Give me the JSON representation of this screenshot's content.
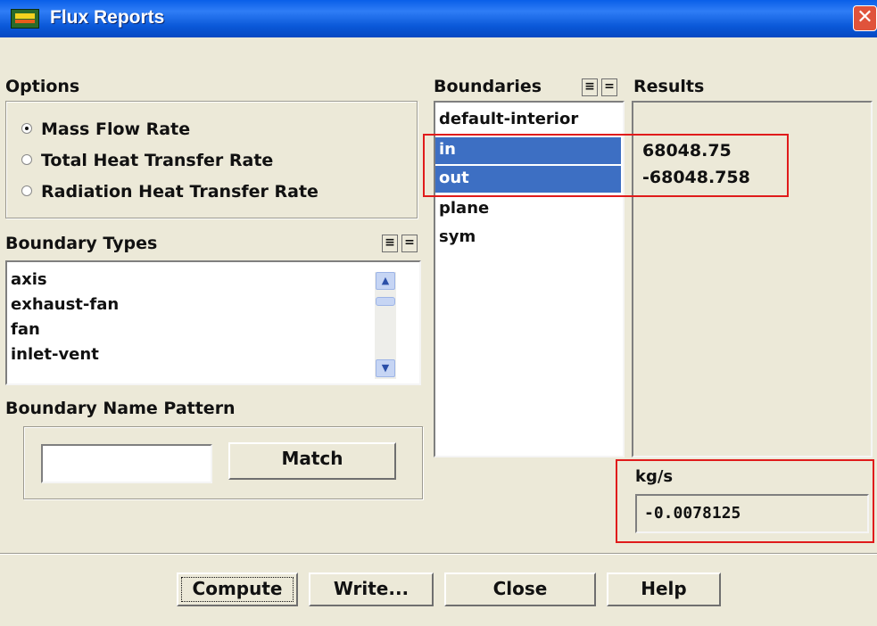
{
  "window": {
    "title": "Flux Reports"
  },
  "options": {
    "label": "Options",
    "radios": [
      {
        "label": "Mass Flow Rate",
        "selected": true
      },
      {
        "label": "Total Heat Transfer Rate",
        "selected": false
      },
      {
        "label": "Radiation Heat Transfer Rate",
        "selected": false
      }
    ]
  },
  "boundary_types": {
    "label": "Boundary Types",
    "items": [
      "axis",
      "exhaust-fan",
      "fan",
      "inlet-vent"
    ]
  },
  "name_pattern": {
    "label": "Boundary Name Pattern",
    "value": "",
    "match_label": "Match"
  },
  "boundaries": {
    "label": "Boundaries",
    "items": [
      {
        "label": "default-interior",
        "selected": false
      },
      {
        "label": "in",
        "selected": true
      },
      {
        "label": "out",
        "selected": true
      },
      {
        "label": "plane",
        "selected": false
      },
      {
        "label": "sym",
        "selected": false
      }
    ]
  },
  "results": {
    "label": "Results",
    "values": [
      "68048.75",
      "-68048.758"
    ],
    "unit": "kg/s",
    "net": "-0.0078125"
  },
  "buttons": {
    "compute": "Compute",
    "write": "Write...",
    "close": "Close",
    "help": "Help"
  },
  "colors": {
    "selection": "#3d6fc3",
    "highlight_box": "#e01b1b",
    "titlebar": "#0a58d8"
  }
}
